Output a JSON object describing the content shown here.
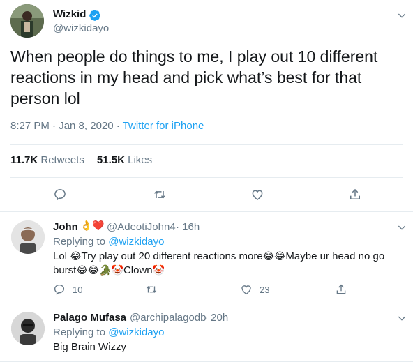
{
  "main_tweet": {
    "author_name": "Wizkid",
    "author_handle": "@wizkidayo",
    "text": "When people do things to me, I play out 10 different reactions in my head and pick what’s best for that person  lol",
    "timestamp": "8:27 PM · Jan 8, 2020 · ",
    "source": "Twitter for iPhone",
    "retweets_count": "11.7K",
    "retweets_label": "Retweets",
    "likes_count": "51.5K",
    "likes_label": "Likes"
  },
  "replies": [
    {
      "author_name": "John",
      "name_emojis": "👌❤️",
      "author_handle": "@AdeotiJohn4",
      "time": "· 16h",
      "replying_prefix": "Replying to ",
      "replying_to": "@wizkidayo",
      "text_parts": [
        "Lol ",
        "😂",
        "Try play out 20 different reactions more",
        "😂😂",
        "Maybe ur head no go",
        "burst",
        "😂😂",
        " 🐊",
        "🤡",
        "Clown",
        "🤡"
      ],
      "reply_count": "10",
      "retweet_count": "",
      "like_count": "23"
    },
    {
      "author_name": "Palago Mufasa",
      "author_handle": "@archipalagodb",
      "time": "· 20h",
      "replying_prefix": "Replying to ",
      "replying_to": "@wizkidayo",
      "text": "Big Brain Wizzy"
    }
  ],
  "colors": {
    "accent": "#1da1f2",
    "secondary_text": "#657786",
    "primary_text": "#14171a",
    "border": "#e6ecf0"
  },
  "icons": [
    "verified-badge-icon",
    "chevron-down-icon",
    "reply-icon",
    "retweet-icon",
    "like-icon",
    "share-icon"
  ]
}
